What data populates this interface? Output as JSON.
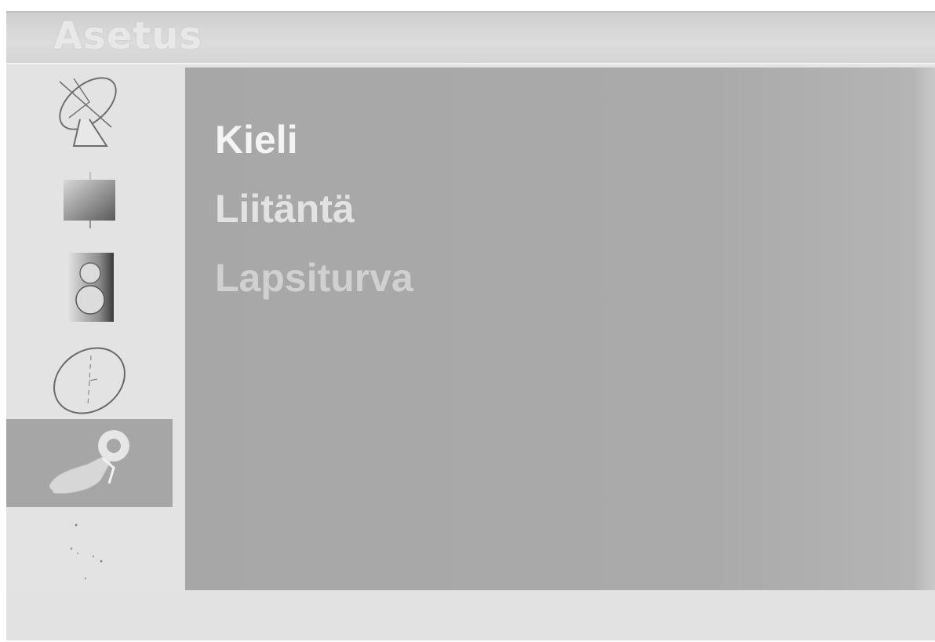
{
  "header": {
    "title": "Asetus"
  },
  "sidebar": {
    "items": [
      {
        "icon": "satellite-dish-icon",
        "selected": false
      },
      {
        "icon": "picture-icon",
        "selected": false
      },
      {
        "icon": "speaker-icon",
        "selected": false
      },
      {
        "icon": "clock-icon",
        "selected": false
      },
      {
        "icon": "setup-key-icon",
        "selected": true
      },
      {
        "icon": "extra-icon",
        "selected": false
      }
    ]
  },
  "menu": {
    "items": [
      {
        "label": "Kieli"
      },
      {
        "label": "Liitäntä"
      },
      {
        "label": "Lapsiturva"
      }
    ]
  },
  "colors": {
    "panel": "#aaaaaa",
    "selected": "#a6a6a6",
    "frame": "#e3e3e3"
  }
}
